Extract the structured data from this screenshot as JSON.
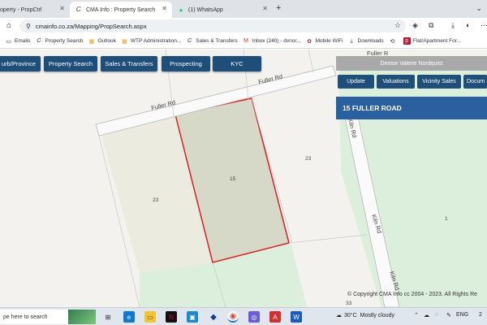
{
  "browser": {
    "tabs": [
      {
        "title": "operty - PropCtrl",
        "icon": "tab-page-icon"
      },
      {
        "title": "CMA Info : Property Search",
        "icon": "cma-icon",
        "active": true
      },
      {
        "title": "(1) WhatsApp",
        "icon": "whatsapp-icon"
      }
    ],
    "url": "cmainfo.co.za/Mapping/PropSearch.aspx",
    "bookmarks": [
      {
        "label": "Emails",
        "icon": "folder-icon"
      },
      {
        "label": "Property Search",
        "icon": "cma-icon"
      },
      {
        "label": "Outlook",
        "icon": "windows-icon"
      },
      {
        "label": "WTP Administration...",
        "icon": "windows-icon"
      },
      {
        "label": "Sales & Transfers",
        "icon": "cma-icon"
      },
      {
        "label": "Inbox (240) - dvnor...",
        "icon": "gmail-icon"
      },
      {
        "label": "Mobile WiFi",
        "icon": "huawei-icon"
      },
      {
        "label": "Downloads",
        "icon": "download-icon"
      },
      {
        "label": "",
        "icon": "history-icon"
      },
      {
        "label": "Flat/Apartment For...",
        "icon": "property24-icon"
      }
    ]
  },
  "app": {
    "nav_buttons": [
      "urb/Province",
      "Property Search",
      "Sales & Transfers",
      "Prospecting",
      "KYC"
    ],
    "owner": "Denise Valerie Nordquist",
    "action_buttons": [
      "Update",
      "Valuations",
      "Vicinity Sales",
      "Docum"
    ],
    "address": "15 FULLER ROAD",
    "copyright": "© Copyright CMA Info cc 2004 - 2023. All Rights Re"
  },
  "map": {
    "roads": [
      "Fuller Rd",
      "Fuller Rd",
      "Kiln Rd",
      "Kiln Rd",
      "Kiln Rd",
      "Fuller R"
    ],
    "erf_labels": [
      "15",
      "23",
      "23",
      "1",
      "33"
    ],
    "selected_color": "#dd1f1f"
  },
  "taskbar": {
    "search_placeholder": "pe here to search",
    "weather_temp": "30°C",
    "weather_desc": "Mostly cloudy",
    "lang": "ENG",
    "clock": "2"
  }
}
